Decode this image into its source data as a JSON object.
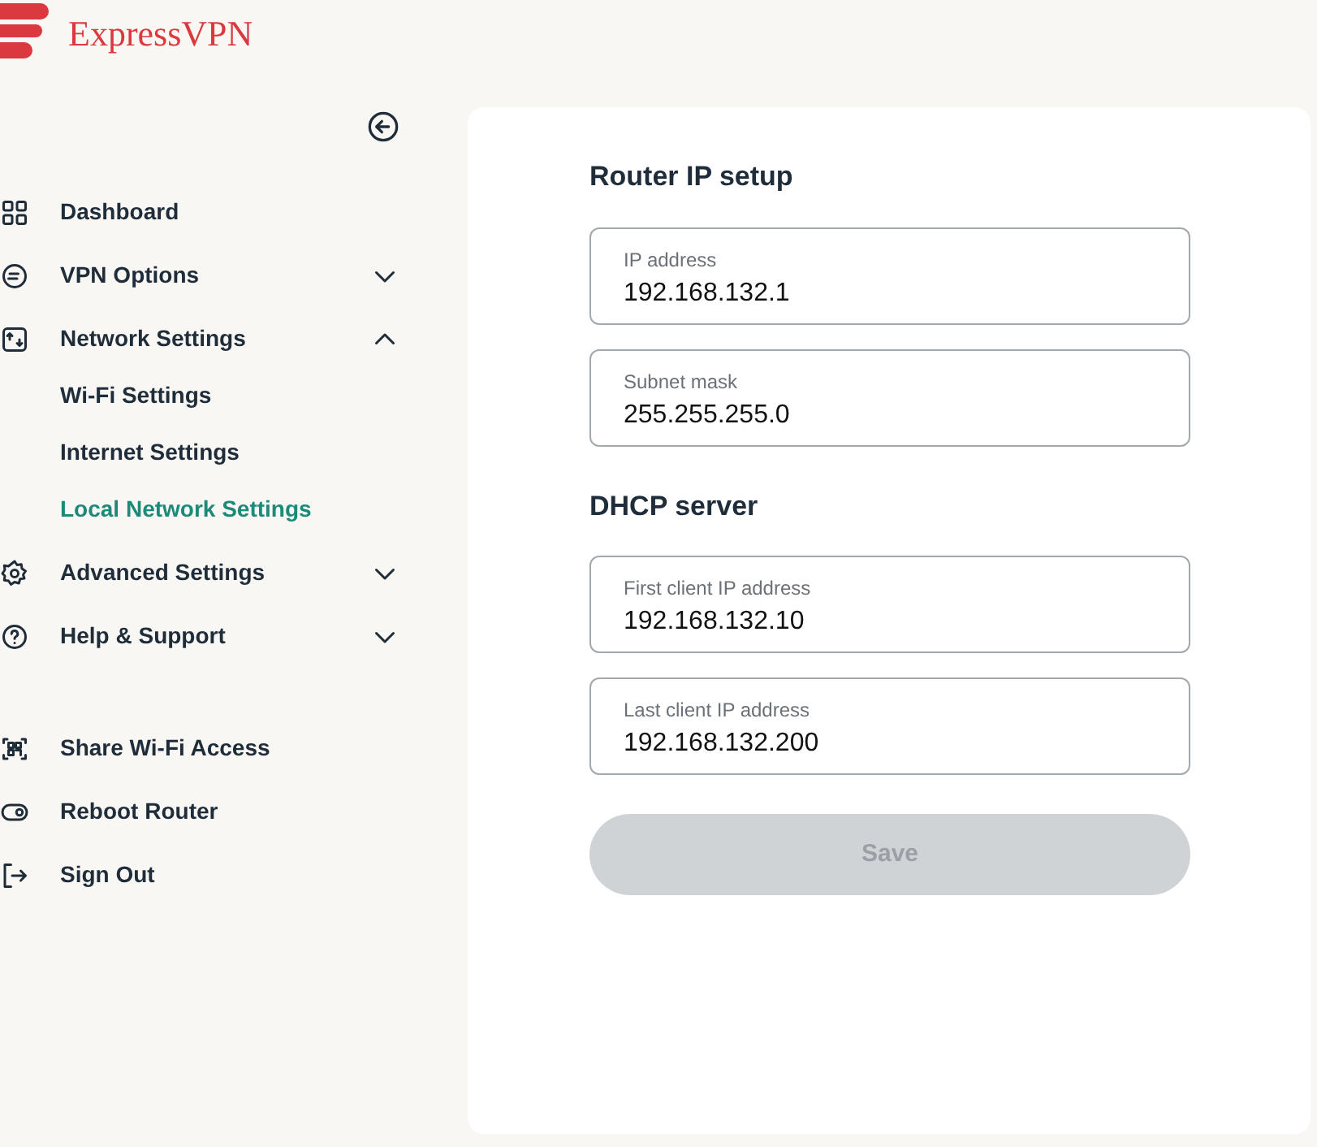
{
  "brand": "ExpressVPN",
  "nav": [
    {
      "kind": "item",
      "label": "Dashboard"
    },
    {
      "kind": "group",
      "label": "VPN Options",
      "expanded": false
    },
    {
      "kind": "group",
      "label": "Network Settings",
      "expanded": true,
      "children": [
        {
          "label": "Wi-Fi Settings",
          "selected": false
        },
        {
          "label": "Internet Settings",
          "selected": false
        },
        {
          "label": "Local Network Settings",
          "selected": true
        }
      ]
    },
    {
      "kind": "group",
      "label": "Advanced Settings",
      "expanded": false
    },
    {
      "kind": "group",
      "label": "Help & Support",
      "expanded": false
    }
  ],
  "actions": [
    {
      "label": "Share Wi-Fi Access"
    },
    {
      "label": "Reboot Router"
    },
    {
      "label": "Sign Out"
    }
  ],
  "sections": [
    {
      "title": "Router IP setup",
      "fields": [
        {
          "label": "IP address",
          "value": "192.168.132.1"
        },
        {
          "label": "Subnet mask",
          "value": "255.255.255.0"
        }
      ]
    },
    {
      "title": "DHCP server",
      "fields": [
        {
          "label": "First client IP address",
          "value": "192.168.132.10"
        },
        {
          "label": "Last client IP address",
          "value": "192.168.132.200"
        }
      ]
    }
  ],
  "save": {
    "label": "Save",
    "disabled": true
  }
}
